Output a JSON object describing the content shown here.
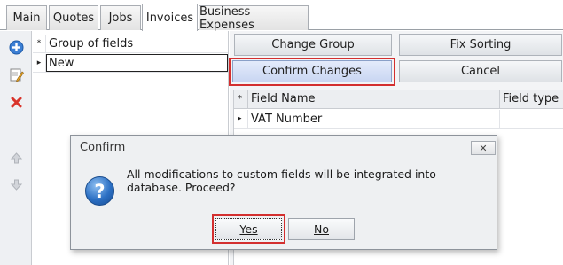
{
  "tabs": [
    {
      "label": "Main",
      "active": false
    },
    {
      "label": "Quotes",
      "active": false
    },
    {
      "label": "Jobs",
      "active": false
    },
    {
      "label": "Invoices",
      "active": true
    },
    {
      "label": "Business Expenses",
      "active": false
    }
  ],
  "toolbar": {
    "icons": [
      "add-icon",
      "edit-icon",
      "delete-icon",
      "move-up-icon",
      "move-down-icon"
    ]
  },
  "group_grid": {
    "header": {
      "marker": "*",
      "label": "Group of fields"
    },
    "rows": [
      {
        "marker": "▸",
        "value": "New",
        "selected": true
      }
    ]
  },
  "actions": {
    "change_group": "Change Group",
    "fix_sorting": "Fix Sorting",
    "confirm_changes": "Confirm Changes",
    "cancel": "Cancel"
  },
  "field_grid": {
    "header_marker": "*",
    "columns": [
      "Field Name",
      "Field type"
    ],
    "rows": [
      {
        "marker": "▸",
        "field_name": "VAT Number",
        "field_type": ""
      }
    ]
  },
  "dialog": {
    "title": "Confirm",
    "close_symbol": "✕",
    "icon": "question-icon",
    "icon_glyph": "?",
    "message": "All modifications to custom fields will be integrated into database. Proceed?",
    "yes_label": "Yes",
    "no_label": "No"
  },
  "colors": {
    "highlight": "#d32f2f",
    "pressed_button": "#c9d6f2",
    "icon_blue": "#2b6fc3"
  }
}
